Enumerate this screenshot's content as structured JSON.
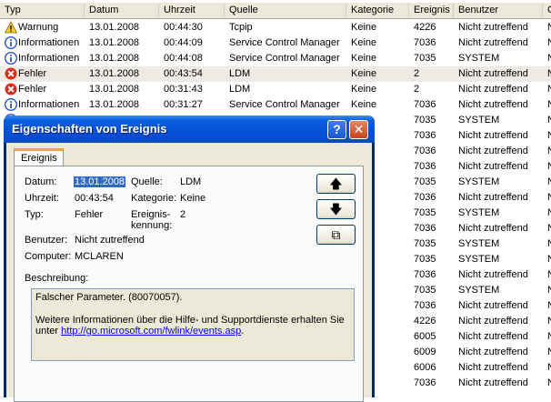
{
  "columns": [
    "Typ",
    "Datum",
    "Uhrzeit",
    "Quelle",
    "Kategorie",
    "Ereignis",
    "Benutzer",
    "C"
  ],
  "rows": [
    {
      "icon": "warning",
      "typ": "Warnung",
      "datum": "13.01.2008",
      "uhrzeit": "00:44:30",
      "quelle": "Tcpip",
      "kategorie": "Keine",
      "ereignis": "4226",
      "benutzer": "Nicht zutreffend",
      "c": "N"
    },
    {
      "icon": "info",
      "typ": "Informationen",
      "datum": "13.01.2008",
      "uhrzeit": "00:44:09",
      "quelle": "Service Control Manager",
      "kategorie": "Keine",
      "ereignis": "7036",
      "benutzer": "Nicht zutreffend",
      "c": "N"
    },
    {
      "icon": "info",
      "typ": "Informationen",
      "datum": "13.01.2008",
      "uhrzeit": "00:44:08",
      "quelle": "Service Control Manager",
      "kategorie": "Keine",
      "ereignis": "7035",
      "benutzer": "SYSTEM",
      "c": "N"
    },
    {
      "icon": "error",
      "typ": "Fehler",
      "datum": "13.01.2008",
      "uhrzeit": "00:43:54",
      "quelle": "LDM",
      "kategorie": "Keine",
      "ereignis": "2",
      "benutzer": "Nicht zutreffend",
      "c": "N",
      "selected": true
    },
    {
      "icon": "error",
      "typ": "Fehler",
      "datum": "13.01.2008",
      "uhrzeit": "00:31:43",
      "quelle": "LDM",
      "kategorie": "Keine",
      "ereignis": "2",
      "benutzer": "Nicht zutreffend",
      "c": "N"
    },
    {
      "icon": "info",
      "typ": "Informationen",
      "datum": "13.01.2008",
      "uhrzeit": "00:31:27",
      "quelle": "Service Control Manager",
      "kategorie": "Keine",
      "ereignis": "7036",
      "benutzer": "Nicht zutreffend",
      "c": "N"
    },
    {
      "icon": "info",
      "ereignis": "7035",
      "benutzer": "SYSTEM",
      "c": "N"
    },
    {
      "icon": "info",
      "ereignis": "7036",
      "benutzer": "Nicht zutreffend",
      "c": "N"
    },
    {
      "icon": "info",
      "ereignis": "7036",
      "benutzer": "Nicht zutreffend",
      "c": "N"
    },
    {
      "icon": "info",
      "ereignis": "7036",
      "benutzer": "Nicht zutreffend",
      "c": "N"
    },
    {
      "icon": "info",
      "ereignis": "7035",
      "benutzer": "SYSTEM",
      "c": "N"
    },
    {
      "icon": "info",
      "ereignis": "7036",
      "benutzer": "Nicht zutreffend",
      "c": "N"
    },
    {
      "icon": "info",
      "ereignis": "7035",
      "benutzer": "SYSTEM",
      "c": "N"
    },
    {
      "icon": "info",
      "ereignis": "7036",
      "benutzer": "Nicht zutreffend",
      "c": "N"
    },
    {
      "icon": "info",
      "ereignis": "7035",
      "benutzer": "SYSTEM",
      "c": "N"
    },
    {
      "icon": "info",
      "ereignis": "7035",
      "benutzer": "SYSTEM",
      "c": "N"
    },
    {
      "icon": "info",
      "ereignis": "7036",
      "benutzer": "Nicht zutreffend",
      "c": "N"
    },
    {
      "icon": "info",
      "ereignis": "7035",
      "benutzer": "SYSTEM",
      "c": "N"
    },
    {
      "icon": "info",
      "ereignis": "7036",
      "benutzer": "Nicht zutreffend",
      "c": "N"
    },
    {
      "icon": "info",
      "ereignis": "4226",
      "benutzer": "Nicht zutreffend",
      "c": "N"
    },
    {
      "icon": "info",
      "ereignis": "6005",
      "benutzer": "Nicht zutreffend",
      "c": "N"
    },
    {
      "icon": "info",
      "ereignis": "6009",
      "benutzer": "Nicht zutreffend",
      "c": "N"
    },
    {
      "icon": "info",
      "ereignis": "6006",
      "benutzer": "Nicht zutreffend",
      "c": "N"
    },
    {
      "icon": "info",
      "ereignis": "7036",
      "benutzer": "Nicht zutreffend",
      "c": "N"
    }
  ],
  "dialog": {
    "title": "Eigenschaften von Ereignis",
    "help_symbol": "?",
    "close_symbol": "✕",
    "tab": "Ereignis",
    "datum_label": "Datum:",
    "datum": "13.01.2008",
    "uhrzeit_label": "Uhrzeit:",
    "uhrzeit": "00:43:54",
    "typ_label": "Typ:",
    "typ": "Fehler",
    "benutzer_label": "Benutzer:",
    "benutzer": "Nicht zutreffend",
    "computer_label": "Computer:",
    "computer": "MCLAREN",
    "quelle_label": "Quelle:",
    "quelle": "LDM",
    "kategorie_label": "Kategorie:",
    "kategorie": "Keine",
    "ereignis_label_1": "Ereignis-",
    "ereignis_label_2": "kennung:",
    "ereignis": "2",
    "up_symbol": "🡅",
    "down_symbol": "🡇",
    "copy_symbol": "⧉",
    "beschreibung_label": "Beschreibung:",
    "desc_line1": "Falscher Parameter.  (80070057).",
    "desc_line2": "Weitere Informationen über die Hilfe- und Supportdienste erhalten Sie",
    "desc_line3_prefix": "unter ",
    "desc_link": "http://go.microsoft.com/fwlink/events.asp",
    "desc_line3_suffix": "."
  },
  "colors": {
    "title_bar": "#0551d6",
    "selection": "#316ac5",
    "error_icon": "#d7301f",
    "warning_icon": "#f7d21c",
    "info_icon": "#2b54c4"
  }
}
